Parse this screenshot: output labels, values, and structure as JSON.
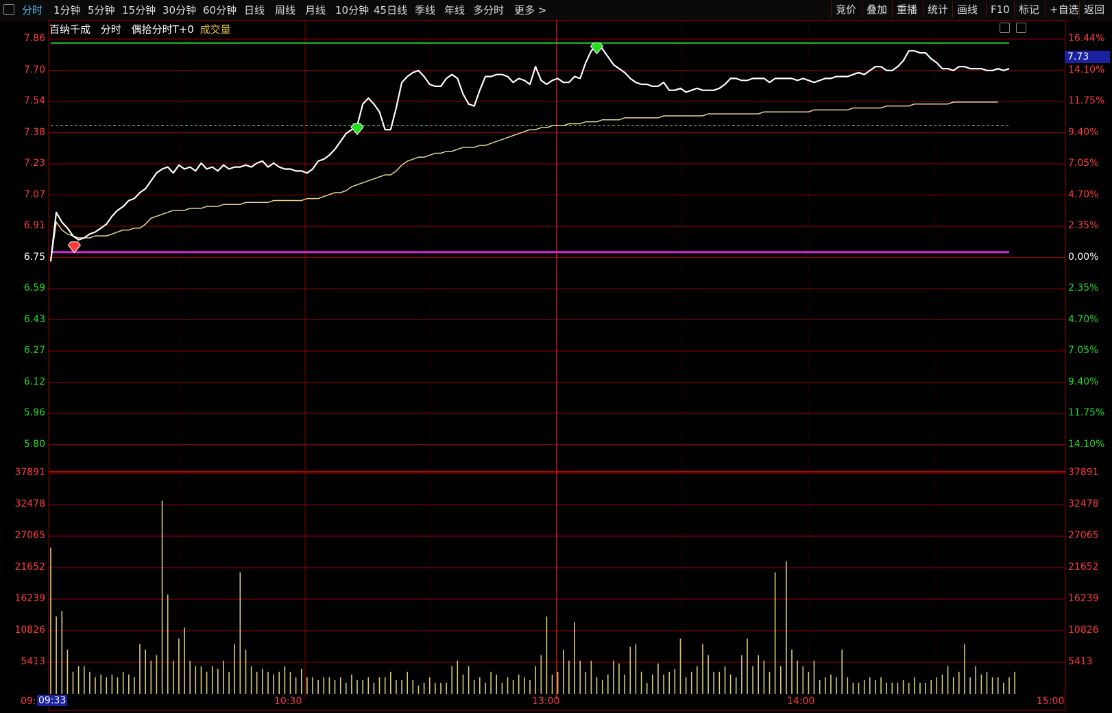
{
  "toolbar": {
    "period_tabs": [
      "分时",
      "1分钟",
      "5分钟",
      "15分钟",
      "30分钟",
      "60分钟",
      "日线",
      "周线",
      "月线",
      "10分钟",
      "45日线",
      "季线",
      "年线",
      "多分时",
      "更多 >"
    ],
    "right_buttons": [
      "竞价",
      "叠加",
      "重播",
      "统计",
      "画线",
      "F10",
      "标记",
      "+自选",
      "返回"
    ]
  },
  "info": {
    "stock_name": "百纳千成",
    "mode": "分时",
    "indicator": "偶拾分时T+0",
    "volume_label": "成交量"
  },
  "axes": {
    "price_left": [
      "7.86",
      "7.70",
      "7.54",
      "7.38",
      "7.23",
      "7.07",
      "6.91",
      "6.75",
      "6.59",
      "6.43",
      "6.27",
      "6.12",
      "5.96",
      "5.80"
    ],
    "pct_right": [
      "16.44%",
      "14.10%",
      "11.75%",
      "9.40%",
      "7.05%",
      "4.70%",
      "2.35%",
      "0.00%",
      "2.35%",
      "4.70%",
      "7.05%",
      "9.40%",
      "11.75%",
      "14.10%"
    ],
    "volume_left": [
      "37891",
      "32478",
      "27065",
      "21652",
      "16239",
      "10826",
      "5413"
    ],
    "time_labels": [
      "09:",
      "10:30",
      "13:00",
      "14:00",
      "15:00"
    ],
    "cursor_time": "09:33",
    "current_price": "7.73"
  },
  "colors": {
    "up": "#ff3b3b",
    "down": "#22dd22",
    "grid": "#9a0000",
    "price_line": "#ffffff",
    "avg_line": "#e8d890",
    "volume": "#d8cc7a",
    "limit_up_line": "#22cc22",
    "base_line": "#dd22dd"
  },
  "chart_data": {
    "type": "line",
    "price_range": [
      5.8,
      7.86
    ],
    "prev_close": 6.75,
    "volume_range": [
      0,
      40000
    ],
    "price_series": [
      6.73,
      6.98,
      6.93,
      6.9,
      6.86,
      6.84,
      6.85,
      6.87,
      6.88,
      6.9,
      6.92,
      6.96,
      6.99,
      7.01,
      7.04,
      7.05,
      7.08,
      7.1,
      7.14,
      7.18,
      7.2,
      7.21,
      7.18,
      7.22,
      7.2,
      7.21,
      7.19,
      7.23,
      7.2,
      7.21,
      7.19,
      7.22,
      7.2,
      7.21,
      7.21,
      7.22,
      7.21,
      7.23,
      7.24,
      7.21,
      7.23,
      7.21,
      7.2,
      7.2,
      7.19,
      7.19,
      7.18,
      7.2,
      7.24,
      7.25,
      7.27,
      7.3,
      7.34,
      7.38,
      7.4,
      7.42,
      7.53,
      7.56,
      7.53,
      7.49,
      7.4,
      7.4,
      7.51,
      7.64,
      7.67,
      7.69,
      7.7,
      7.67,
      7.63,
      7.62,
      7.62,
      7.66,
      7.68,
      7.66,
      7.58,
      7.53,
      7.52,
      7.6,
      7.67,
      7.67,
      7.68,
      7.68,
      7.67,
      7.64,
      7.66,
      7.65,
      7.63,
      7.72,
      7.65,
      7.63,
      7.65,
      7.66,
      7.64,
      7.64,
      7.67,
      7.66,
      7.74,
      7.8,
      7.83,
      7.81,
      7.77,
      7.73,
      7.71,
      7.69,
      7.66,
      7.64,
      7.63,
      7.63,
      7.62,
      7.62,
      7.64,
      7.6,
      7.6,
      7.61,
      7.59,
      7.6,
      7.61,
      7.6,
      7.6,
      7.6,
      7.61,
      7.63,
      7.66,
      7.66,
      7.65,
      7.65,
      7.66,
      7.66,
      7.66,
      7.64,
      7.66,
      7.66,
      7.66,
      7.66,
      7.65,
      7.66,
      7.65,
      7.64,
      7.65,
      7.66,
      7.66,
      7.67,
      7.67,
      7.67,
      7.68,
      7.69,
      7.68,
      7.7,
      7.72,
      7.72,
      7.7,
      7.7,
      7.72,
      7.75,
      7.8,
      7.8,
      7.79,
      7.79,
      7.76,
      7.74,
      7.71,
      7.71,
      7.7,
      7.72,
      7.72,
      7.71,
      7.71,
      7.71,
      7.7,
      7.7,
      7.71,
      7.7,
      7.71
    ],
    "avg_series": [
      6.73,
      6.93,
      6.89,
      6.87,
      6.86,
      6.85,
      6.85,
      6.85,
      6.86,
      6.86,
      6.86,
      6.87,
      6.88,
      6.89,
      6.89,
      6.9,
      6.9,
      6.92,
      6.95,
      6.96,
      6.97,
      6.98,
      6.99,
      6.99,
      6.99,
      7.0,
      7.0,
      7.0,
      7.01,
      7.01,
      7.01,
      7.02,
      7.02,
      7.02,
      7.02,
      7.03,
      7.03,
      7.03,
      7.03,
      7.03,
      7.04,
      7.04,
      7.04,
      7.04,
      7.04,
      7.04,
      7.05,
      7.05,
      7.05,
      7.06,
      7.07,
      7.08,
      7.08,
      7.09,
      7.11,
      7.12,
      7.13,
      7.14,
      7.15,
      7.16,
      7.17,
      7.17,
      7.19,
      7.22,
      7.24,
      7.25,
      7.26,
      7.26,
      7.27,
      7.28,
      7.28,
      7.29,
      7.29,
      7.3,
      7.31,
      7.31,
      7.31,
      7.32,
      7.32,
      7.33,
      7.34,
      7.35,
      7.36,
      7.37,
      7.38,
      7.39,
      7.4,
      7.4,
      7.41,
      7.41,
      7.42,
      7.42,
      7.42,
      7.43,
      7.43,
      7.43,
      7.44,
      7.44,
      7.44,
      7.45,
      7.45,
      7.45,
      7.45,
      7.46,
      7.46,
      7.46,
      7.46,
      7.46,
      7.46,
      7.46,
      7.47,
      7.47,
      7.47,
      7.47,
      7.47,
      7.47,
      7.47,
      7.47,
      7.48,
      7.48,
      7.48,
      7.48,
      7.48,
      7.48,
      7.48,
      7.48,
      7.48,
      7.48,
      7.49,
      7.49,
      7.49,
      7.49,
      7.49,
      7.49,
      7.49,
      7.49,
      7.49,
      7.5,
      7.5,
      7.5,
      7.5,
      7.5,
      7.5,
      7.5,
      7.51,
      7.51,
      7.51,
      7.51,
      7.51,
      7.51,
      7.52,
      7.52,
      7.52,
      7.52,
      7.52,
      7.53,
      7.53,
      7.53,
      7.53,
      7.53,
      7.53,
      7.53,
      7.54,
      7.54,
      7.54,
      7.54,
      7.54,
      7.54,
      7.54,
      7.54,
      7.54
    ],
    "volume_series": [
      26500,
      14000,
      15000,
      8000,
      4000,
      5000,
      5000,
      4000,
      3000,
      3500,
      3000,
      3500,
      3000,
      4000,
      3500,
      3000,
      9000,
      8000,
      6000,
      7000,
      35000,
      18000,
      6000,
      10000,
      12000,
      6000,
      5000,
      5000,
      4000,
      5000,
      4500,
      6000,
      4000,
      9000,
      22000,
      8000,
      5000,
      4000,
      4500,
      4000,
      3500,
      4000,
      5000,
      4000,
      3000,
      4500,
      3000,
      3000,
      2500,
      3000,
      3000,
      2500,
      3000,
      2000,
      3500,
      2500,
      2500,
      3000,
      2000,
      3000,
      3000,
      4000,
      2500,
      2500,
      4000,
      2500,
      1500,
      2000,
      3000,
      2000,
      2000,
      2000,
      5000,
      6000,
      3500,
      5000,
      2500,
      3000,
      2000,
      4000,
      3500,
      2000,
      3000,
      2500,
      3500,
      3000,
      2500,
      5000,
      7000,
      14000,
      3500,
      4000,
      8000,
      6000,
      13000,
      6000,
      4000,
      6000,
      3000,
      2500,
      3500,
      6000,
      5500,
      3500,
      8500,
      9000,
      4000,
      2000,
      3500,
      5500,
      3500,
      4000,
      4500,
      10000,
      3000,
      4000,
      5000,
      9000,
      7000,
      4000,
      4000,
      5000,
      3500,
      3000,
      7000,
      10000,
      5000,
      7000,
      6000,
      4000,
      22000,
      5000,
      24000,
      8000,
      6000,
      5000,
      4000,
      6000,
      2500,
      3000,
      3500,
      3000,
      8000,
      3000,
      2000,
      2000,
      2500,
      3000,
      2500,
      3000,
      2000,
      2000,
      2000,
      2500,
      2000,
      3000,
      2000,
      2000,
      2500,
      3000,
      3500,
      5000,
      3000,
      4000,
      9000,
      3000,
      5000,
      3500,
      4000,
      3000,
      3000,
      2000,
      3000,
      4000
    ],
    "buy_marker_index": 3,
    "sell_marker_indices": [
      55,
      98
    ],
    "limit_up_price": 7.84,
    "avg_end_line_price": 7.42
  }
}
